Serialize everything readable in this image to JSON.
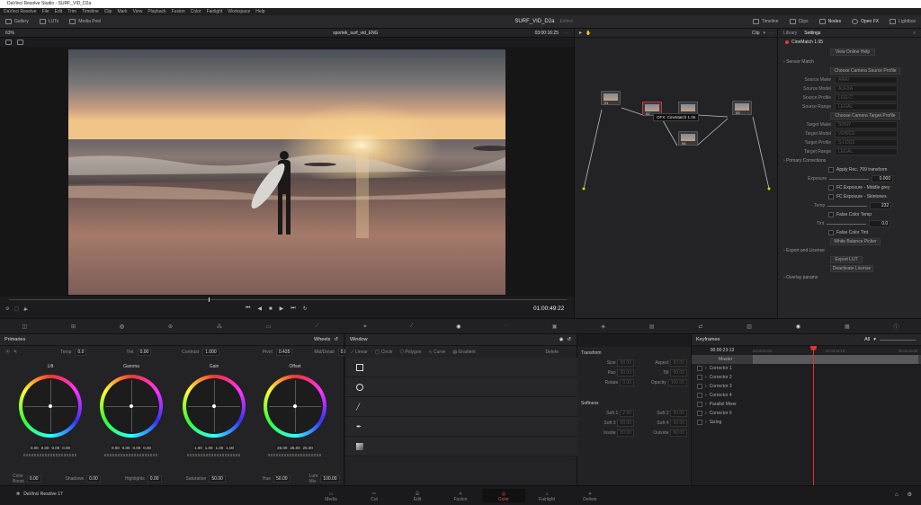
{
  "window_title": "DaVinci Resolve Studio - SURF_VID_D2a",
  "menu": [
    "DaVinci Resolve",
    "File",
    "Edit",
    "Trim",
    "Timeline",
    "Clip",
    "Mark",
    "View",
    "Playback",
    "Fusion",
    "Color",
    "Fairlight",
    "Workspace",
    "Help"
  ],
  "toolbar": {
    "gallery": "Gallery",
    "luts": "LUTs",
    "media_pool": "Media Pool",
    "project_name": "SURF_VID_D2a",
    "project_status": "Edited",
    "timeline": "Timeline",
    "clips": "Clips",
    "nodes": "Nodes",
    "open_fx": "Open FX",
    "lightbox": "Lightbox"
  },
  "viewer": {
    "zoom": "63%",
    "clip_name": "sportek_surf_vid_ENG",
    "timecode_top": "03:00:16:25",
    "timecode": "01:00:49:22"
  },
  "node_editor": {
    "mode": "Clip",
    "node_labels": [
      "01",
      "02",
      "03",
      "04"
    ],
    "tooltip": "OFX: CineMatch 1.05"
  },
  "settings": {
    "tabs": [
      "Library",
      "Settings"
    ],
    "plugin_name": "CineMatch 1.05",
    "view_help": "View Online Help",
    "sensor_match": "Sensor Match",
    "choose_source": "Choose Camera Source Profile",
    "source_fields": [
      {
        "label": "Source Make",
        "value": "ARRI"
      },
      {
        "label": "Source Model",
        "value": "ALEXA"
      },
      {
        "label": "Source Profile",
        "value": "LOG-C"
      },
      {
        "label": "Source Range",
        "value": "LEGAL"
      }
    ],
    "choose_target": "Choose Camera Target Profile",
    "target_fields": [
      {
        "label": "Target Make",
        "value": "SONY"
      },
      {
        "label": "Target Model",
        "value": "VENICE"
      },
      {
        "label": "Target Profile",
        "value": "S-LOG3"
      },
      {
        "label": "Target Range",
        "value": "LEGAL"
      }
    ],
    "primary_corrections": "Primary Corrections",
    "apply_rec709": "Apply Rec. 709 transform",
    "exposure_label": "Exposure",
    "exposure_value": "0.000",
    "fc_midgrey": "FC Exposure - Middle grey",
    "fc_skintones": "FC Exposure - Skintones",
    "temp_label": "Temp",
    "temp_value": "232",
    "false_color_temp": "False Color Temp",
    "tint_label": "Tint",
    "tint_value": "0.0",
    "false_color_tint": "False Color Tint",
    "wb_picker": "White Balance Picker",
    "export_license": "Export and License",
    "export_lut": "Export LUT",
    "deactivate": "Deactivate License",
    "overlay_params": "Overlay params"
  },
  "primaries": {
    "title": "Primaries",
    "mode": "Wheels",
    "temp_label": "Temp",
    "temp_value": "0.0",
    "tint_label": "Tint",
    "tint_value": "0.00",
    "contrast_label": "Contrast",
    "contrast_value": "1.000",
    "pivot_label": "Pivot",
    "pivot_value": "0.435",
    "middetail_label": "Mid/Detail",
    "middetail_value": "0.00",
    "wheels": [
      {
        "name": "Lift",
        "values": [
          "0.00",
          "0.00",
          "0.00",
          "0.00"
        ]
      },
      {
        "name": "Gamma",
        "values": [
          "0.00",
          "0.00",
          "0.00",
          "0.00"
        ]
      },
      {
        "name": "Gain",
        "values": [
          "1.00",
          "1.00",
          "1.00",
          "1.00"
        ]
      },
      {
        "name": "Offset",
        "values": [
          "25.00",
          "25.00",
          "25.00"
        ]
      }
    ],
    "color_boost_label": "Color Boost",
    "color_boost_value": "0.00",
    "shadows_label": "Shadows",
    "shadows_value": "0.00",
    "highlights_label": "Highlights",
    "highlights_value": "0.00",
    "saturation_label": "Saturation",
    "saturation_value": "50.00",
    "hue_label": "Hue",
    "hue_value": "50.00",
    "lum_mix_label": "Lum Mix",
    "lum_mix_value": "100.00"
  },
  "window_panel": {
    "title": "Window",
    "shapes": [
      "Linear",
      "Circle",
      "Polygon",
      "Curve",
      "Gradient"
    ],
    "delete": "Delete",
    "transform": "Transform",
    "transform_fields": [
      {
        "label": "Size",
        "value": "50.00"
      },
      {
        "label": "Aspect",
        "value": "50.00"
      },
      {
        "label": "Pan",
        "value": "50.00"
      },
      {
        "label": "Tilt",
        "value": "50.00"
      },
      {
        "label": "Rotate",
        "value": "0.00"
      },
      {
        "label": "Opacity",
        "value": "100.00"
      }
    ],
    "softness": "Softness",
    "softness_fields": [
      {
        "label": "Soft 1",
        "value": "2.50"
      },
      {
        "label": "Soft 2",
        "value": "50.00"
      },
      {
        "label": "Soft 3",
        "value": "50.00"
      },
      {
        "label": "Soft 4",
        "value": "50.00"
      },
      {
        "label": "Inside",
        "value": "50.00"
      },
      {
        "label": "Outside",
        "value": "50.00"
      }
    ]
  },
  "keyframes": {
    "title": "Keyframes",
    "filter": "All",
    "timecode": "00:00:23:13",
    "ruler": [
      "00:00:00:00",
      "00:00:14:18",
      "00:00:29:06"
    ],
    "tracks": [
      "Master",
      "Corrector 1",
      "Corrector 2",
      "Corrector 3",
      "Corrector 4",
      "Parallel Mixer",
      "Corrector 6",
      "Sizing"
    ]
  },
  "pages": {
    "app": "DaVinci Resolve 17",
    "items": [
      "Media",
      "Cut",
      "Edit",
      "Fusion",
      "Color",
      "Fairlight",
      "Deliver"
    ],
    "active": "Color"
  }
}
